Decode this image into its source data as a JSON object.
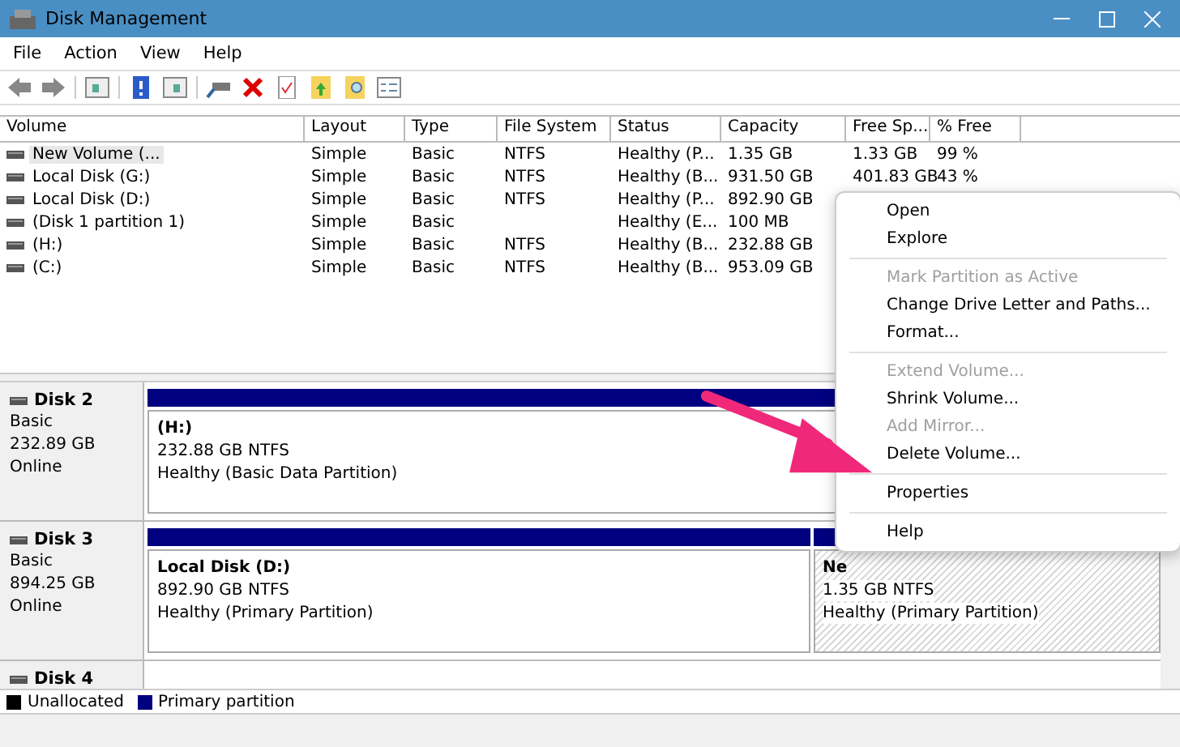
{
  "window": {
    "title": "Disk Management"
  },
  "menu_bar": [
    "File",
    "Action",
    "View",
    "Help"
  ],
  "table": {
    "columns": [
      "Volume",
      "Layout",
      "Type",
      "File System",
      "Status",
      "Capacity",
      "Free Sp...",
      "% Free"
    ],
    "rows": [
      {
        "selected": true,
        "cells": [
          "New Volume (...",
          "Simple",
          "Basic",
          "NTFS",
          "Healthy (P...",
          "1.35 GB",
          "1.33 GB",
          "99 %"
        ]
      },
      {
        "selected": false,
        "cells": [
          "Local Disk (G:)",
          "Simple",
          "Basic",
          "NTFS",
          "Healthy (B...",
          "931.50 GB",
          "401.83 GB",
          "43 %"
        ]
      },
      {
        "selected": false,
        "cells": [
          "Local Disk (D:)",
          "Simple",
          "Basic",
          "NTFS",
          "Healthy (P...",
          "892.90 GB"
        ]
      },
      {
        "selected": false,
        "cells": [
          "(Disk 1 partition 1)",
          "Simple",
          "Basic",
          "",
          "Healthy (E...",
          "100 MB"
        ]
      },
      {
        "selected": false,
        "cells": [
          "(H:)",
          "Simple",
          "Basic",
          "NTFS",
          "Healthy (B...",
          "232.88 GB"
        ]
      },
      {
        "selected": false,
        "cells": [
          "(C:)",
          "Simple",
          "Basic",
          "NTFS",
          "Healthy (B...",
          "953.09 GB"
        ]
      }
    ]
  },
  "disks": [
    {
      "name": "Disk 2",
      "type": "Basic",
      "size": "232.89 GB",
      "status": "Online",
      "partitions": [
        {
          "label": "(H:)",
          "size": "232.88 GB NTFS",
          "status": "Healthy (Basic Data Partition)",
          "selected": false
        }
      ]
    },
    {
      "name": "Disk 3",
      "type": "Basic",
      "size": "894.25 GB",
      "status": "Online",
      "partitions": [
        {
          "label": "Local Disk  (D:)",
          "size": "892.90 GB NTFS",
          "status": "Healthy (Primary Partition)",
          "selected": false
        },
        {
          "label": "Ne",
          "size": "1.35 GB NTFS",
          "status": "Healthy (Primary Partition)",
          "selected": true
        }
      ]
    },
    {
      "name": "Disk 4"
    }
  ],
  "legend": [
    {
      "label": "Unallocated",
      "color": "#000000"
    },
    {
      "label": "Primary partition",
      "color": "#000080"
    }
  ],
  "context_menu": [
    {
      "label": "Open",
      "disabled": false,
      "separator_after": false
    },
    {
      "label": "Explore",
      "disabled": false,
      "separator_after": true
    },
    {
      "label": "Mark Partition as Active",
      "disabled": true,
      "separator_after": false
    },
    {
      "label": "Change Drive Letter and Paths...",
      "disabled": false,
      "separator_after": false
    },
    {
      "label": "Format...",
      "disabled": false,
      "separator_after": true
    },
    {
      "label": "Extend Volume...",
      "disabled": true,
      "separator_after": false
    },
    {
      "label": "Shrink Volume...",
      "disabled": false,
      "separator_after": false
    },
    {
      "label": "Add Mirror...",
      "disabled": true,
      "separator_after": false
    },
    {
      "label": "Delete Volume...",
      "disabled": false,
      "separator_after": true
    },
    {
      "label": "Properties",
      "disabled": false,
      "separator_after": true
    },
    {
      "label": "Help",
      "disabled": false,
      "separator_after": false
    }
  ]
}
